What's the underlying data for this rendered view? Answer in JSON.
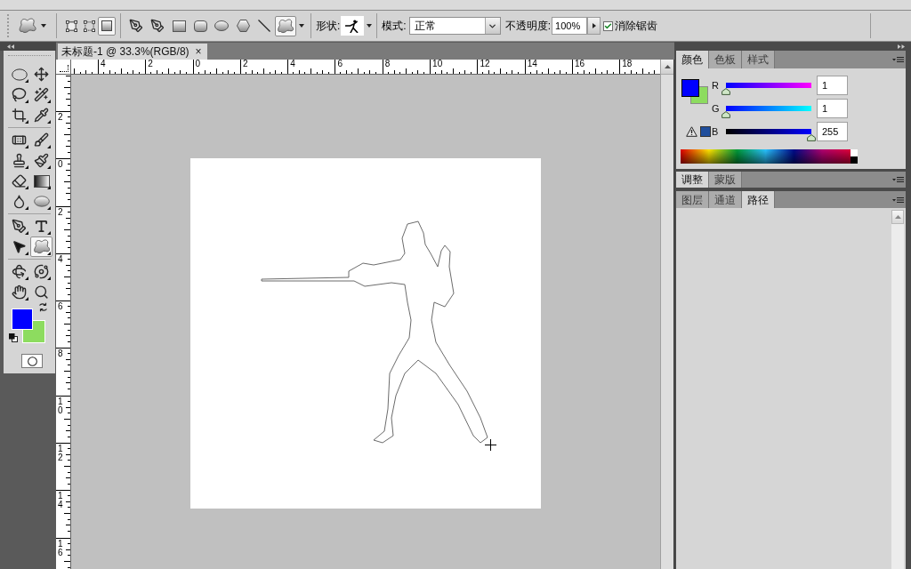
{
  "options_bar": {
    "path_modes": [
      {
        "kind": "shape_layers",
        "selected": false
      },
      {
        "kind": "paths",
        "selected": false
      },
      {
        "kind": "fill_pixels",
        "selected": true
      }
    ],
    "shape_tools": [
      {
        "kind": "pen",
        "selected": false
      },
      {
        "kind": "freeform_pen",
        "selected": false
      },
      {
        "kind": "rectangle",
        "selected": false
      },
      {
        "kind": "rounded_rectangle",
        "selected": false
      },
      {
        "kind": "ellipse",
        "selected": false
      },
      {
        "kind": "polygon",
        "selected": false
      },
      {
        "kind": "line",
        "selected": false
      },
      {
        "kind": "custom_shape",
        "selected": true
      }
    ],
    "shape_label": "形状:",
    "mode_label": "模式:",
    "mode_value": "正常",
    "opacity_label": "不透明度:",
    "opacity_value": "100%",
    "anti_alias": {
      "label": "消除锯齿",
      "checked": true
    }
  },
  "toolbox": {
    "groups": [
      [
        {
          "kind": "elliptical_marquee",
          "submenu": true,
          "selected": false
        },
        {
          "kind": "move",
          "submenu": false,
          "selected": false
        },
        {
          "kind": "lasso",
          "submenu": true,
          "selected": false
        },
        {
          "kind": "magic_wand",
          "submenu": true,
          "selected": false
        },
        {
          "kind": "crop",
          "submenu": true,
          "selected": false
        },
        {
          "kind": "eyedropper",
          "submenu": true,
          "selected": false
        }
      ],
      [
        {
          "kind": "spot_healing",
          "submenu": true,
          "selected": false
        },
        {
          "kind": "brush",
          "submenu": true,
          "selected": false
        },
        {
          "kind": "clone_stamp",
          "submenu": true,
          "selected": false
        },
        {
          "kind": "history_brush",
          "submenu": true,
          "selected": false
        },
        {
          "kind": "eraser",
          "submenu": true,
          "selected": false
        },
        {
          "kind": "gradient",
          "submenu": true,
          "selected": false
        },
        {
          "kind": "blur",
          "submenu": true,
          "selected": false
        },
        {
          "kind": "sponge",
          "submenu": true,
          "selected": false
        }
      ],
      [
        {
          "kind": "pen",
          "submenu": true,
          "selected": false
        },
        {
          "kind": "type",
          "submenu": true,
          "selected": false
        },
        {
          "kind": "path_selection",
          "submenu": true,
          "selected": false
        },
        {
          "kind": "custom_shape",
          "submenu": true,
          "selected": true
        }
      ],
      [
        {
          "kind": "rotate_3d",
          "submenu": true,
          "selected": false
        },
        {
          "kind": "orbit_3d",
          "submenu": true,
          "selected": false
        },
        {
          "kind": "hand",
          "submenu": true,
          "selected": false
        },
        {
          "kind": "zoom",
          "submenu": false,
          "selected": false
        }
      ]
    ],
    "color_swatches": [
      {
        "kind": "foreground",
        "color": "#0000ff"
      },
      {
        "kind": "background",
        "color": "#8ddc5f"
      }
    ]
  },
  "document": {
    "tab": {
      "title": "未标题-1 @ 33.3%(RGB/8)",
      "close": "×"
    },
    "horizontal_ruler": [
      "4",
      "2",
      "0",
      "2",
      "4",
      "6",
      "8",
      "10",
      "12",
      "14",
      "16",
      "18"
    ],
    "vertical_ruler": [
      "2",
      "0",
      "2",
      "4",
      "6",
      "8",
      "10",
      "12",
      "14",
      "16"
    ]
  },
  "color_panel": {
    "tabs": [
      {
        "label": "颜色",
        "selected": true
      },
      {
        "label": "色板",
        "selected": false
      },
      {
        "label": "样式",
        "selected": false
      }
    ],
    "swatches": [
      {
        "kind": "foreground",
        "color": "#0000ff"
      },
      {
        "kind": "background",
        "color": "#8ddc5f"
      },
      {
        "kind": "gamut_warning",
        "color": "#1f4e9c"
      }
    ],
    "channels": [
      {
        "name": "R",
        "value": "1",
        "level": 0.004
      },
      {
        "name": "G",
        "value": "1",
        "level": 0.004
      },
      {
        "name": "B",
        "value": "255",
        "level": 1
      }
    ]
  },
  "adjustments_panel": {
    "tabs": [
      {
        "label": "调整",
        "selected": true
      },
      {
        "label": "蒙版",
        "selected": false
      }
    ]
  },
  "layers_panel": {
    "tabs": [
      {
        "label": "图层",
        "selected": false
      },
      {
        "label": "通道",
        "selected": false
      },
      {
        "label": "路径",
        "selected": true
      }
    ]
  }
}
